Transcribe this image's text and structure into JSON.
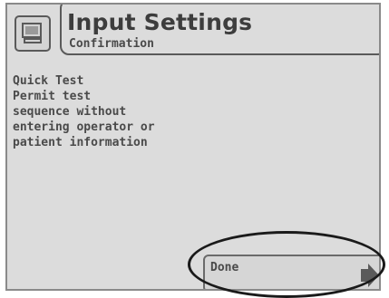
{
  "header": {
    "title": "Input Settings",
    "subtitle": "Confirmation",
    "icon": "monitor-icon"
  },
  "content": {
    "lines": [
      "Quick Test",
      "Permit test",
      "sequence without",
      "entering operator or",
      "patient information"
    ]
  },
  "footer": {
    "done_label": "Done",
    "done_icon": "arrow-right-icon"
  }
}
